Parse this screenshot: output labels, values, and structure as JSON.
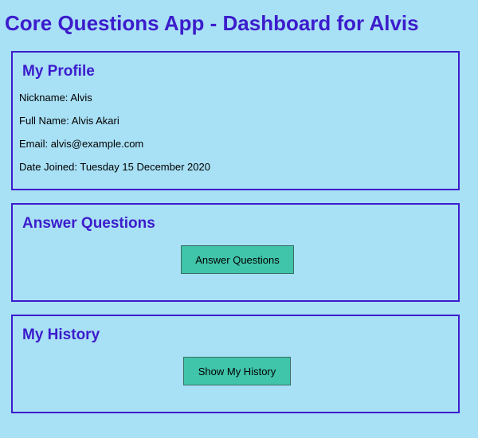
{
  "page": {
    "title": "Core Questions App - Dashboard for Alvis"
  },
  "profile": {
    "heading": "My Profile",
    "nickname_label": "Nickname",
    "nickname": "Alvis",
    "full_name_label": "Full Name",
    "full_name": "Alvis Akari",
    "email_label": "Email",
    "email": "alvis@example.com",
    "date_joined_label": "Date Joined",
    "date_joined": "Tuesday 15 December 2020"
  },
  "answer_questions": {
    "heading": "Answer Questions",
    "button_label": "Answer Questions"
  },
  "history": {
    "heading": "My History",
    "button_label": "Show My History"
  },
  "colors": {
    "background": "#a8e0f5",
    "accent": "#3c1ccc",
    "button": "#40c4aa"
  }
}
